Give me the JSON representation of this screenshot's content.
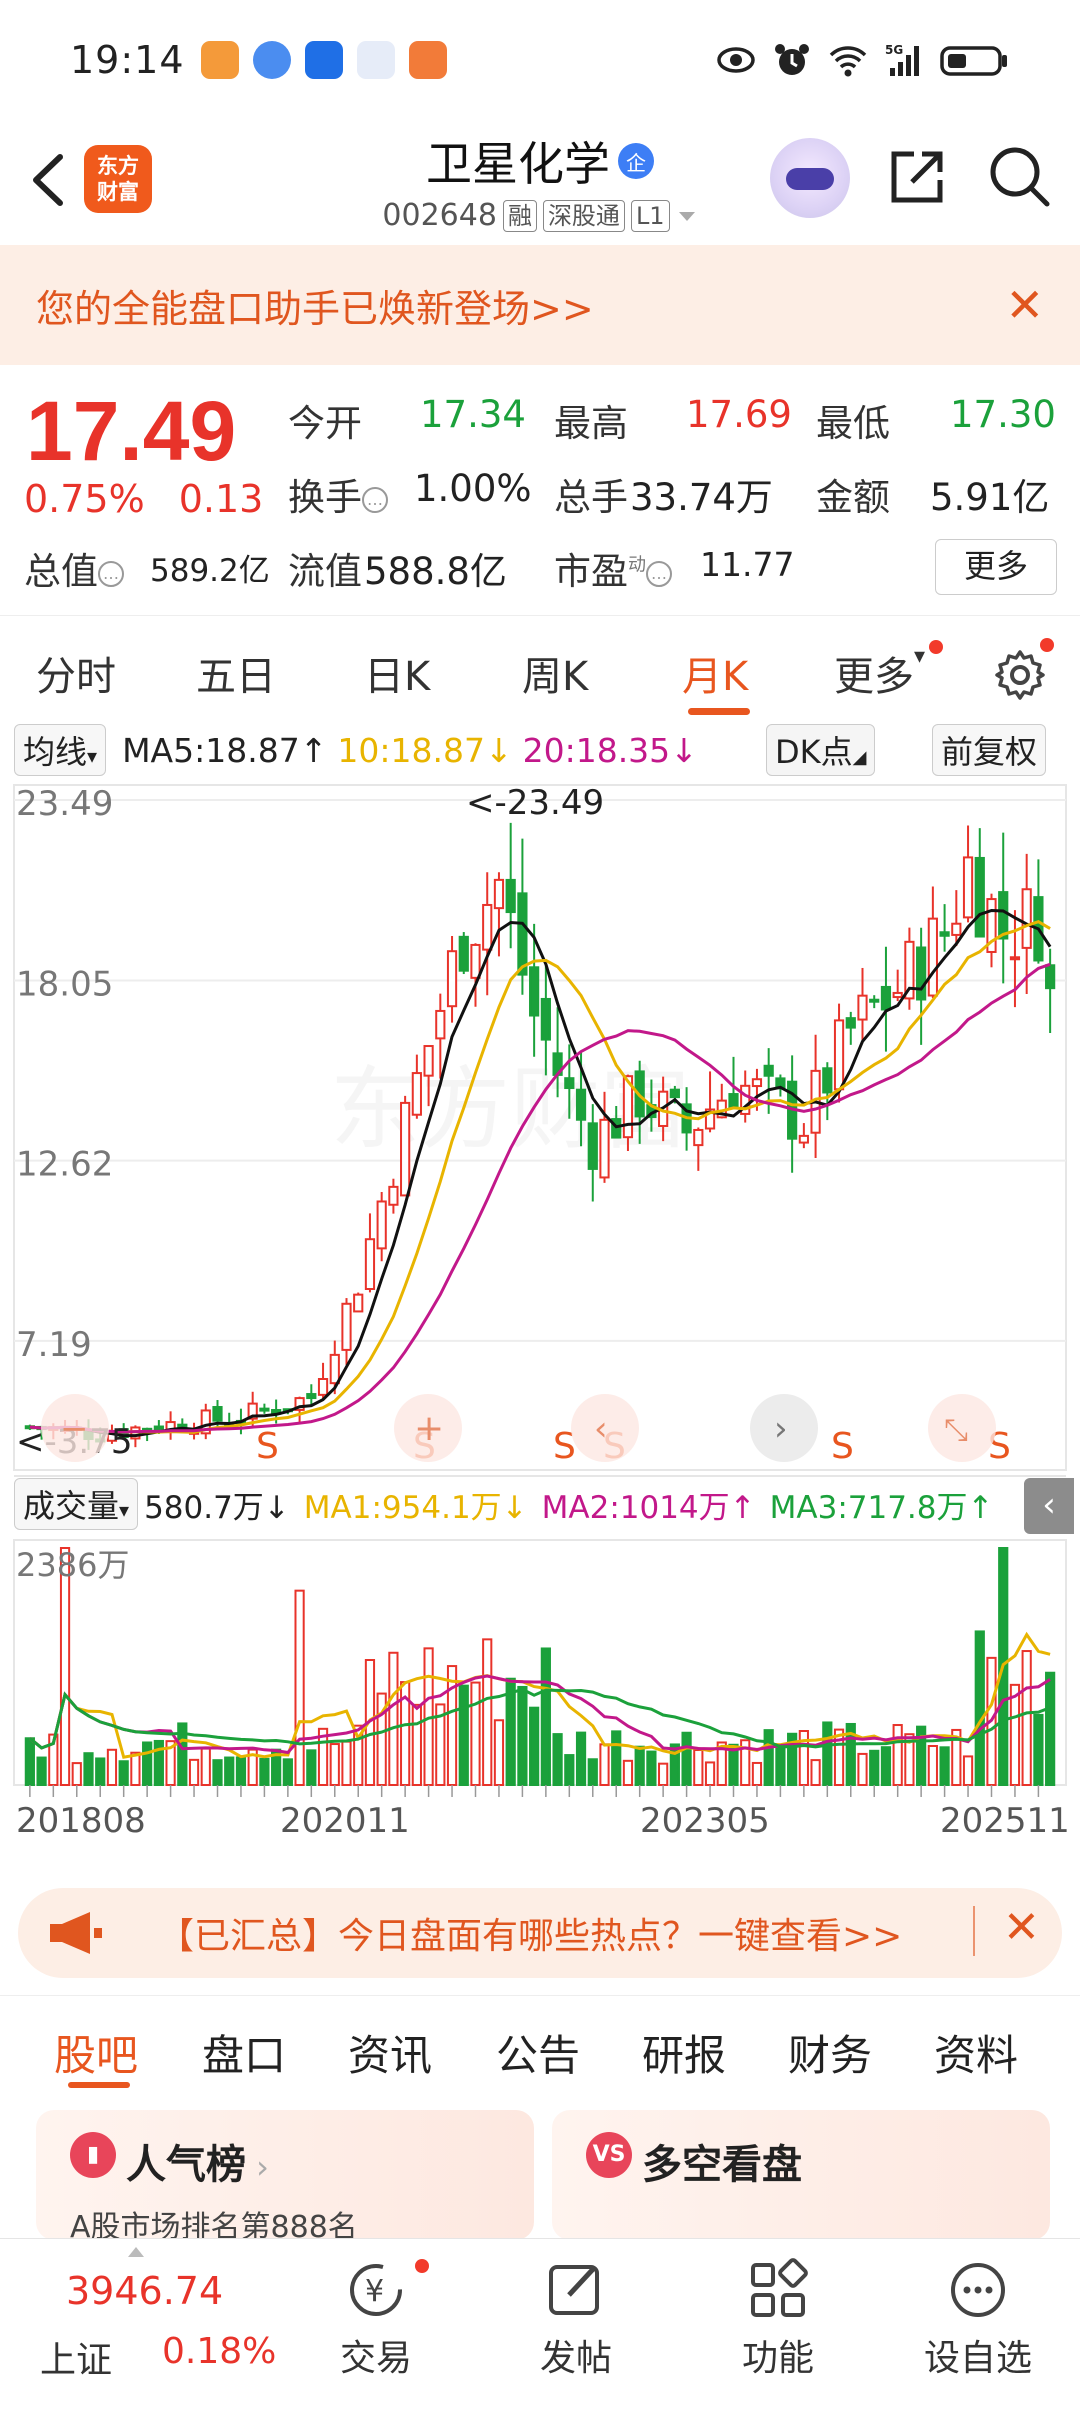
{
  "status_bar": {
    "time": "19:14"
  },
  "header": {
    "logo_line1": "东方",
    "logo_line2": "财富",
    "stock_name": "卫星化学",
    "name_badge": "企",
    "stock_code": "002648",
    "tags": [
      "融",
      "深股通",
      "L1"
    ]
  },
  "banner": {
    "text": "您的全能盘口助手已焕新登场>>"
  },
  "quote": {
    "price": "17.49",
    "change_pct": "0.75%",
    "change_amt": "0.13",
    "open_label": "今开",
    "open": "17.34",
    "high_label": "最高",
    "high": "17.69",
    "low_label": "最低",
    "low": "17.30",
    "turnover_label": "换手",
    "turnover": "1.00%",
    "volume_label": "总手",
    "volume": "33.74万",
    "amount_label": "金额",
    "amount": "5.91亿",
    "mktcap_label": "总值",
    "mktcap": "589.2亿",
    "float_label": "流值",
    "float_cap": "588.8亿",
    "pe_label": "市盈",
    "pe_sup": "动",
    "pe": "11.77",
    "more_label": "更多"
  },
  "tabs": [
    "分时",
    "五日",
    "日K",
    "周K",
    "月K",
    "更多",
    "settings"
  ],
  "ma_row": {
    "selector": "均线",
    "ma5": "MA5:18.87↑",
    "ma10": "10:18.87↓",
    "ma20": "20:18.35↓",
    "dk_btn": "DK点",
    "adj_btn": "前复权"
  },
  "chart_data": {
    "type": "candlestick",
    "y_ticks": [
      "23.49",
      "18.05",
      "12.62",
      "7.19"
    ],
    "ylim": [
      3.75,
      23.49
    ],
    "max_marker": "<-23.49",
    "min_marker": "<-3.75",
    "signal_label": "S",
    "x_ticks": [
      "201808",
      "202011",
      "202305",
      "202511"
    ],
    "colors": {
      "up": "#e8332a",
      "down": "#1ba13b",
      "ma5": "#111111",
      "ma10": "#e8b400",
      "ma20": "#c2188a"
    }
  },
  "volume": {
    "selector": "成交量",
    "current": "580.7万↓",
    "ma1": "MA1:954.1万↓",
    "ma2": "MA2:1014万↑",
    "ma3": "MA3:717.8万↑",
    "max_label": "2386万"
  },
  "hot_bar": {
    "text": "【已汇总】今日盘面有哪些热点？一键查看>>"
  },
  "bottom_tabs": [
    "股吧",
    "盘口",
    "资讯",
    "公告",
    "研报",
    "财务",
    "资料"
  ],
  "cards": {
    "left_title": "人气榜",
    "left_sub": "A股市场排名第888名",
    "right_title": "多空看盘",
    "right_icon": "VS"
  },
  "nav": {
    "index_value": "3946.74",
    "index_name": "上证",
    "index_pct": "0.18%",
    "items": [
      "交易",
      "发帖",
      "功能",
      "设自选"
    ]
  }
}
